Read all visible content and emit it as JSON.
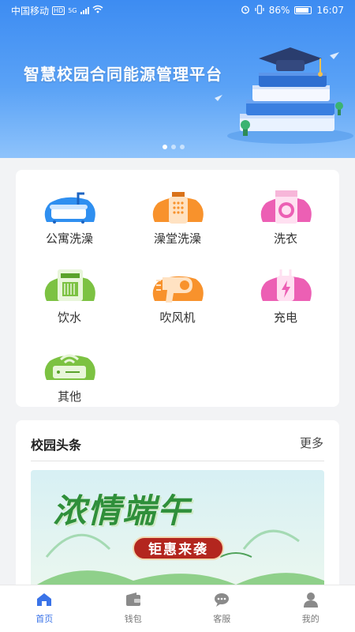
{
  "status_bar": {
    "carrier": "中国移动",
    "network_badge": "HD",
    "signal_label": "5G",
    "battery": "86%",
    "time": "16:07"
  },
  "banner": {
    "title": "智慧校园合同能源管理平台",
    "slide_count": 3,
    "active_slide": 1
  },
  "services": [
    {
      "label": "公寓洗澡",
      "icon": "bathtub-icon",
      "color": "#2f8ff0"
    },
    {
      "label": "澡堂洗澡",
      "icon": "shower-icon",
      "color": "#f8922c"
    },
    {
      "label": "洗衣",
      "icon": "washing-machine-icon",
      "color": "#ec5fb4"
    },
    {
      "label": "饮水",
      "icon": "water-dispenser-icon",
      "color": "#7cc242"
    },
    {
      "label": "吹风机",
      "icon": "hair-dryer-icon",
      "color": "#f8922c"
    },
    {
      "label": "充电",
      "icon": "charging-icon",
      "color": "#ec5fb4"
    },
    {
      "label": "其他",
      "icon": "router-icon",
      "color": "#7cc242"
    }
  ],
  "news": {
    "title": "校园头条",
    "more": "更多",
    "banner_headline": "浓情端午",
    "banner_badge": "钜惠来袭"
  },
  "tabbar": {
    "items": [
      {
        "label": "首页",
        "icon": "home-icon",
        "active": true
      },
      {
        "label": "钱包",
        "icon": "wallet-icon",
        "active": false
      },
      {
        "label": "客服",
        "icon": "chat-icon",
        "active": false
      },
      {
        "label": "我的",
        "icon": "user-icon",
        "active": false
      }
    ]
  },
  "colors": {
    "accent": "#3a73e8",
    "banner": "#3d8cf2",
    "blue": "#2f8ff0",
    "orange": "#f8922c",
    "pink": "#ec5fb4",
    "green": "#7cc242"
  }
}
